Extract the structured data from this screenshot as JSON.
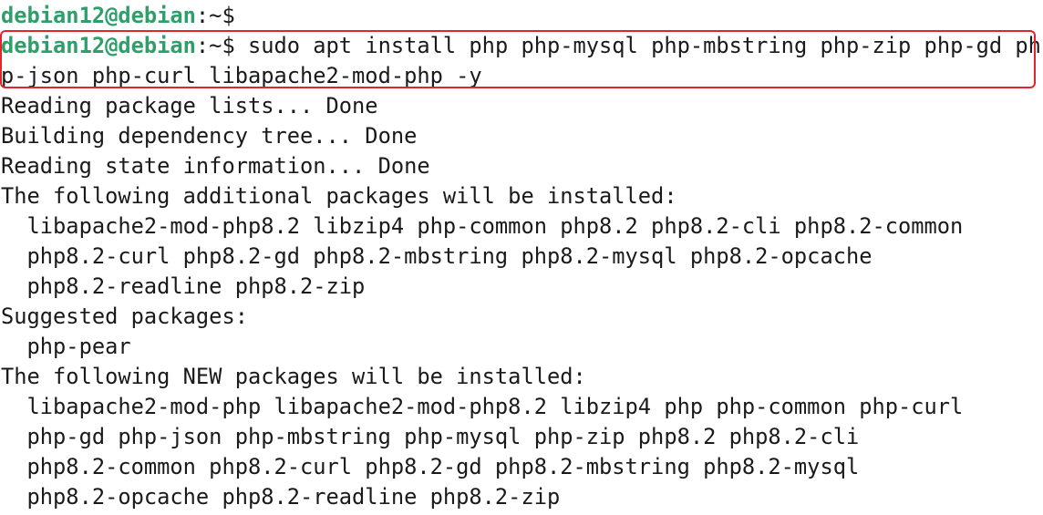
{
  "colors": {
    "background": "#ffffff",
    "text": "#1a1a1a",
    "prompt_user": "#2e9f6a",
    "highlight_border": "#e0262a"
  },
  "prompt1": {
    "user_host": "debian12@debian",
    "suffix": ":~$"
  },
  "prompt2": {
    "user_host": "debian12@debian",
    "suffix": ":~$",
    "command": " sudo apt install php php-mysql php-mbstring php-zip php-gd ph",
    "command_wrap": "p-json php-curl libapache2-mod-php -y"
  },
  "output": [
    "Reading package lists... Done",
    "Building dependency tree... Done",
    "Reading state information... Done",
    "The following additional packages will be installed:",
    "  libapache2-mod-php8.2 libzip4 php-common php8.2 php8.2-cli php8.2-common",
    "  php8.2-curl php8.2-gd php8.2-mbstring php8.2-mysql php8.2-opcache",
    "  php8.2-readline php8.2-zip",
    "Suggested packages:",
    "  php-pear",
    "The following NEW packages will be installed:",
    "  libapache2-mod-php libapache2-mod-php8.2 libzip4 php php-common php-curl",
    "  php-gd php-json php-mbstring php-mysql php-zip php8.2 php8.2-cli",
    "  php8.2-common php8.2-curl php8.2-gd php8.2-mbstring php8.2-mysql",
    "  php8.2-opcache php8.2-readline php8.2-zip"
  ]
}
